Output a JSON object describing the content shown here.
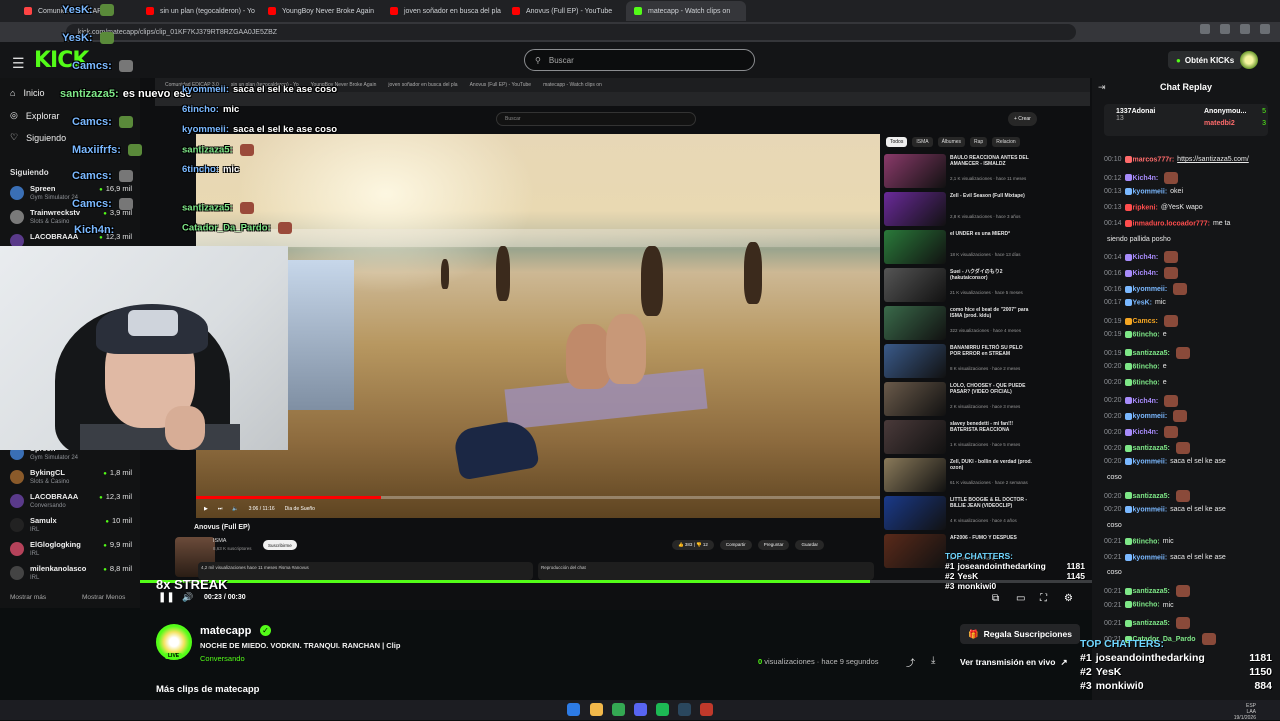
{
  "browser": {
    "tabs": [
      {
        "label": "Comunidad EDICAP 3.0",
        "color": "#ff4444"
      },
      {
        "label": "sin un plan (tegocalderon) - Yo",
        "color": "#ff0000"
      },
      {
        "label": "YoungBoy Never Broke Again",
        "color": "#ff0000"
      },
      {
        "label": "joven soñador en busca del pla",
        "color": "#ff0000"
      },
      {
        "label": "Anovus (Full EP) - YouTube",
        "color": "#ff0000"
      },
      {
        "label": "matecapp - Watch clips on",
        "color": "#53fc18"
      }
    ],
    "url": "kick.com/matecapp/clips/clip_01KF7KJ379RT8RZGAA0JE5ZBZ"
  },
  "kick": {
    "logo": "KICK",
    "search_placeholder": "Buscar",
    "get_kicks": "Obtén KICKs",
    "nav": {
      "home": "Inicio",
      "explore": "Explorar",
      "following": "Siguiendo"
    },
    "following_title": "Siguiendo",
    "sidebar_channels_top": [
      {
        "name": "Spreen",
        "category": "Gym Simulator 24",
        "viewers": "16,9 mil",
        "color": "#3a6fb5"
      },
      {
        "name": "Trainwreckstv",
        "category": "Slots & Casino",
        "viewers": "3,9 mil",
        "color": "#7a7a7a"
      },
      {
        "name": "LACOBRAAA",
        "category": "",
        "viewers": "12,3 mil",
        "color": "#5a3a8a"
      }
    ],
    "sidebar_channels_bottom": [
      {
        "name": "Spreen",
        "category": "Gym Simulator 24",
        "viewers": "",
        "color": "#3a6fb5"
      },
      {
        "name": "BykingCL",
        "category": "Slots & Casino",
        "viewers": "1,8 mil",
        "color": "#8a5a2a"
      },
      {
        "name": "LACOBRAAA",
        "category": "Conversando",
        "viewers": "12,3 mil",
        "color": "#5a3a8a"
      },
      {
        "name": "Samulx",
        "category": "IRL",
        "viewers": "10 mil",
        "color": "#222222"
      },
      {
        "name": "ElGloglogking",
        "category": "IRL",
        "viewers": "9,9 mil",
        "color": "#b5425a"
      },
      {
        "name": "milenkanolasco",
        "category": "IRL",
        "viewers": "8,8 mil",
        "color": "#444444"
      }
    ],
    "show_more": "Mostrar más",
    "show_less": "Mostrar Menos"
  },
  "overlay_chat": [
    {
      "user": "YesK:",
      "text": "",
      "emote_color": "#5a8a3a"
    },
    {
      "user": "YesK:",
      "text": "",
      "emote_color": "#5a8a3a"
    },
    {
      "user": "Camcs:",
      "text": "",
      "emote_color": "#777777"
    },
    {
      "user": "santizaza5:",
      "text": "es nuevo ese",
      "emote_color": ""
    },
    {
      "user": "Camcs:",
      "text": "",
      "emote_color": "#5a8a3a"
    },
    {
      "user": "Maxiifrfs:",
      "text": "",
      "emote_color": "#5a8a3a"
    },
    {
      "user": "Camcs:",
      "text": "",
      "emote_color": "#777777"
    },
    {
      "user": "Camcs:",
      "text": "",
      "emote_color": "#777777"
    },
    {
      "user": "Kich4n:",
      "text": "",
      "emote_color": ""
    },
    {
      "user": "kyommeii:",
      "text": "saca el sel ke ase coso",
      "emote_color": ""
    },
    {
      "user": "6tincho:",
      "text": "mic",
      "emote_color": ""
    },
    {
      "user": "kyommeii:",
      "text": "saca el sel ke ase coso",
      "emote_color": ""
    },
    {
      "user": "santizaza5:",
      "text": "",
      "emote_color": "#9a4a3a"
    },
    {
      "user": "6tincho:",
      "text": "mic",
      "emote_color": ""
    },
    {
      "user": "santizaza5:",
      "text": "",
      "emote_color": "#9a4a3a"
    },
    {
      "user": "Catador_Da_Pardo:",
      "text": "",
      "emote_color": "#9a4a3a"
    }
  ],
  "youtube": {
    "search_placeholder": "Buscar",
    "create": "+ Crear",
    "premium": "Premium",
    "time": "3:06 / 11:16",
    "chapter": "Dia de Sueño",
    "chips": [
      "Todos",
      "ISMA",
      "Álbumes",
      "Rap",
      "Relacion"
    ],
    "video_title": "Anovus (Full EP)",
    "channel": "ISMA",
    "subs": "8,63 K suscriptores",
    "subscribe": "Suscribirme",
    "likes": "383",
    "dislikes": "12",
    "actions": [
      "Compartir",
      "Preguntar",
      "Guardar"
    ],
    "desc": "4,2 mil visualizaciones  hace 11 meses  #isma #anovus",
    "chat_replay": "Reproducción del chat",
    "recommendations": [
      {
        "title": "BAULO REACCIONA ANTES DEL AMANECER - ISMALDZ",
        "meta": "2,1 K visualizaciones · hace 11 meses",
        "color": "#8a3a6a"
      },
      {
        "title": "Zell - Evil Season (Full Mixtape)",
        "meta": "2,8 K visualizaciones · hace 3 años",
        "color": "#6a2a9a"
      },
      {
        "title": "el UNDER es una MIERD*",
        "meta": "18 K visualizaciones · hace 13 días",
        "color": "#2a7a3a"
      },
      {
        "title": "Suei - ハクダイのもり2 (hakutaiconsor)",
        "meta": "21 K visualizaciones · hace 5 meses",
        "color": "#555555"
      },
      {
        "title": "como hice el beat de \"2007\" para ISMA (prod. kldu)",
        "meta": "322 visualizaciones · hace 4 meses",
        "color": "#3a6a4a"
      },
      {
        "title": "BANANIRRU FILTRÓ SU PELO POR ERROR en STREAM",
        "meta": "8 K visualizaciones · hace 2 meses",
        "color": "#3a5a8a"
      },
      {
        "title": "LOLO, CHOOSEY - QUE PUEDE PASAR? (VIDEO OFICIAL)",
        "meta": "2 K visualizaciones · hace 3 meses",
        "color": "#6a5a4a"
      },
      {
        "title": "slavey benedetti - mi fan!!! BATERISTA REACCIONA",
        "meta": "1 K visualizaciones · hace 5 meses",
        "color": "#4a3a3a"
      },
      {
        "title": "Zell, DUKI - bollin de verdad (prod. ozon)",
        "meta": "61 K visualizaciones · hace 2 semanas",
        "color": "#8a7a5a"
      },
      {
        "title": "LITTLE BOOGIE & EL DOCTOR - BILLIE JEAN (VIDEOCLIP)",
        "meta": "4 K visualizaciones · hace 4 años",
        "color": "#1a3a8a"
      },
      {
        "title": "AF2006 - FUMO Y DESPUES",
        "meta": "CRISTA (Video Oficial)",
        "color": "#5a2a1a"
      }
    ]
  },
  "player": {
    "streak": "8x STREAK",
    "time": "00:23 / 00:30",
    "progress": 0.767,
    "top_chatters_title": "TOP CHATTERS:",
    "top_chatters": [
      {
        "rank": "#1",
        "name": "joseandointhedarking",
        "count": "1181"
      },
      {
        "rank": "#2",
        "name": "YesK",
        "count": "1145"
      },
      {
        "rank": "#3",
        "name": "monkiwi0",
        "count": ""
      }
    ]
  },
  "clip_info": {
    "channel": "matecapp",
    "title": "NOCHE DE MIEDO. VODKIN. TRANQUI. RANCHAN | Clip",
    "category": "Conversando",
    "live": "LIVE",
    "views_count": "0",
    "views_label": "visualizaciones",
    "time_ago": "hace 9 segundos",
    "gift_subs": "Regala Suscripciones",
    "watch_live": "Ver transmisión en vivo",
    "more_clips": "Más clips de matecapp"
  },
  "chat_replay": {
    "title": "Chat Replay",
    "pinned": [
      {
        "name": "1337Adonai",
        "count": "13"
      },
      {
        "name": "Anonymou...",
        "count": "5"
      },
      {
        "name": "matedbi2",
        "count": "3"
      }
    ],
    "messages": [
      {
        "time": "00:10",
        "user": "marcos777r:",
        "text": "https://santizaza5.com/",
        "color": "#ff6b6b"
      },
      {
        "time": "00:12",
        "user": "Kich4n:",
        "text": "",
        "color": "#a78bfa"
      },
      {
        "time": "00:13",
        "user": "kyommeii:",
        "text": "okei",
        "color": "#7ab8ff"
      },
      {
        "time": "00:13",
        "user": "ripkeni:",
        "text": "@YesK wapo",
        "color": "#ff4d4d"
      },
      {
        "time": "00:14",
        "user": "inmaduro.locoador777:",
        "text": "me ta",
        "color": "#ff4d4d"
      },
      {
        "time": "",
        "user": "",
        "text": "siendo pallida posho",
        "color": "#e8e8e8"
      },
      {
        "time": "00:14",
        "user": "Kich4n:",
        "text": "",
        "color": "#a78bfa"
      },
      {
        "time": "00:16",
        "user": "Kich4n:",
        "text": "",
        "color": "#a78bfa"
      },
      {
        "time": "00:16",
        "user": "kyommeii:",
        "text": "",
        "color": "#7ab8ff"
      },
      {
        "time": "00:17",
        "user": "YesK:",
        "text": "mic",
        "color": "#7ab8ff"
      },
      {
        "time": "00:19",
        "user": "Camcs:",
        "text": "",
        "color": "#f5a623"
      },
      {
        "time": "00:19",
        "user": "6tincho:",
        "text": "e",
        "color": "#7ee787"
      },
      {
        "time": "00:19",
        "user": "santizaza5:",
        "text": "",
        "color": "#7ee787"
      },
      {
        "time": "00:20",
        "user": "6tincho:",
        "text": "e",
        "color": "#7ee787"
      },
      {
        "time": "00:20",
        "user": "6tincho:",
        "text": "e",
        "color": "#7ee787"
      },
      {
        "time": "00:20",
        "user": "Kich4n:",
        "text": "",
        "color": "#a78bfa"
      },
      {
        "time": "00:20",
        "user": "kyommeii:",
        "text": "",
        "color": "#7ab8ff"
      },
      {
        "time": "00:20",
        "user": "Kich4n:",
        "text": "",
        "color": "#a78bfa"
      },
      {
        "time": "00:20",
        "user": "santizaza5:",
        "text": "",
        "color": "#7ee787"
      },
      {
        "time": "00:20",
        "user": "kyommeii:",
        "text": "saca el sel ke ase",
        "color": "#7ab8ff"
      },
      {
        "time": "",
        "user": "",
        "text": "coso",
        "color": "#e8e8e8"
      },
      {
        "time": "00:20",
        "user": "santizaza5:",
        "text": "",
        "color": "#7ee787"
      },
      {
        "time": "00:20",
        "user": "kyommeii:",
        "text": "saca el sel ke ase",
        "color": "#7ab8ff"
      },
      {
        "time": "",
        "user": "",
        "text": "coso",
        "color": "#e8e8e8"
      },
      {
        "time": "00:21",
        "user": "6tincho:",
        "text": "mic",
        "color": "#7ee787"
      },
      {
        "time": "00:21",
        "user": "kyommeii:",
        "text": "saca el sel ke ase",
        "color": "#7ab8ff"
      },
      {
        "time": "",
        "user": "",
        "text": "coso",
        "color": "#e8e8e8"
      },
      {
        "time": "00:21",
        "user": "santizaza5:",
        "text": "",
        "color": "#7ee787"
      },
      {
        "time": "00:21",
        "user": "6tincho:",
        "text": "mic",
        "color": "#7ee787"
      },
      {
        "time": "00:21",
        "user": "santizaza5:",
        "text": "",
        "color": "#7ee787"
      },
      {
        "time": "00:21",
        "user": "Catador_Da_Pardo",
        "text": "",
        "color": "#7ee787"
      }
    ],
    "top_chatters_title": "TOP CHATTERS:",
    "top_chatters": [
      {
        "rank": "#1",
        "name": "joseandointhedarking",
        "count": "1181"
      },
      {
        "rank": "#2",
        "name": "YesK",
        "count": "1150"
      },
      {
        "rank": "#3",
        "name": "monkiwi0",
        "count": "884"
      }
    ]
  },
  "taskbar": {
    "lang": "ESP",
    "region": "LAA",
    "date": "19/1/2026"
  },
  "colors": {
    "accent": "#53fc18",
    "bg": "#0b0e0f"
  }
}
